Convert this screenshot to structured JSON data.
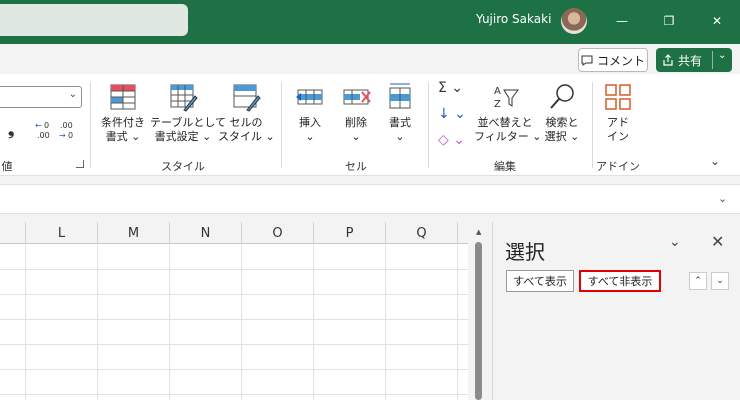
{
  "titlebar": {
    "user_name": "Yujiro Sakaki",
    "minimize_icon": "—",
    "restore_icon": "❐",
    "close_icon": "✕"
  },
  "command_row": {
    "comment_label": "コメント",
    "share_label": "共有",
    "share_caret": "⌄"
  },
  "ribbon": {
    "number_format_value": "",
    "number_buttons": {
      "comma": "❟",
      "inc_decimal": "←0\n.00",
      "dec_decimal": ".00\n→0"
    },
    "groups": {
      "number_label": "値",
      "styles_label": "スタイル",
      "cells_label": "セル",
      "editing_label": "編集",
      "addins_label": "アドイン"
    },
    "buttons": {
      "cond_format": [
        "条件付き",
        "書式 ⌄"
      ],
      "table_format": [
        "テーブルとして",
        "書式設定 ⌄"
      ],
      "cell_styles": [
        "セルの",
        "スタイル ⌄"
      ],
      "insert": [
        "挿入",
        "⌄"
      ],
      "delete": [
        "削除",
        "⌄"
      ],
      "format": [
        "書式",
        "⌄"
      ],
      "sort_filter": [
        "並べ替えと",
        "フィルター ⌄"
      ],
      "find_select": [
        "検索と",
        "選択 ⌄"
      ],
      "addins": [
        "アド",
        "イン"
      ]
    },
    "editing_small": {
      "autosum": "Σ ⌄",
      "fill": "↓ ⌄",
      "clear": "◇ ⌄"
    },
    "collapse_icon": "⌄"
  },
  "formula_bar": {
    "caret": "⌄"
  },
  "grid": {
    "columns": [
      "L",
      "M",
      "N",
      "O",
      "P",
      "Q"
    ]
  },
  "selection_pane": {
    "title": "選択",
    "show_all": "すべて表示",
    "hide_all": "すべて非表示",
    "bring_forward": "⌃",
    "send_backward": "⌄",
    "dropdown_icon": "⌄",
    "close_icon": "✕"
  },
  "colors": {
    "accent": "#1e7145",
    "highlight": "#e00000"
  }
}
